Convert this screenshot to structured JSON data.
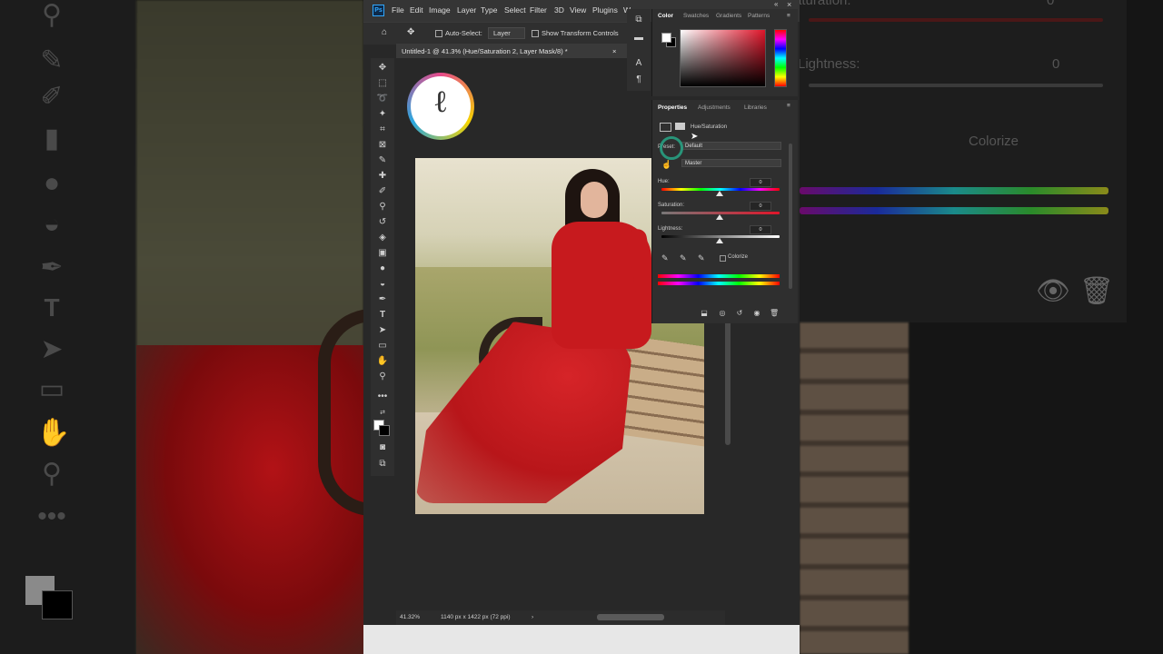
{
  "menubar": {
    "logo": "Ps",
    "items": [
      "File",
      "Edit",
      "Image",
      "Layer",
      "Type",
      "Select",
      "Filter",
      "3D",
      "View",
      "Plugins",
      "W"
    ]
  },
  "options_bar": {
    "auto_select_label": "Auto-Select:",
    "auto_select_value": "Layer",
    "transform_label": "Show Transform Controls"
  },
  "document": {
    "tab_title": "Untitled-1 @ 41.3% (Hue/Saturation 2, Layer Mask/8) *",
    "zoom": "41.32%",
    "dimensions": "1140 px x 1422 px (72 ppi)"
  },
  "color_panel": {
    "tabs": [
      "Color",
      "Swatches",
      "Gradients",
      "Patterns"
    ],
    "active_tab": "Color",
    "foreground": "#ffffff",
    "background": "#000000",
    "selected_hue": "#e0152a"
  },
  "properties_panel": {
    "tabs": [
      "Properties",
      "Adjustments",
      "Libraries"
    ],
    "active_tab": "Properties",
    "adjustment_name": "Hue/Saturation",
    "preset_label": "Preset:",
    "preset_value": "Default",
    "channel_value": "Master",
    "hue_label": "Hue:",
    "hue_value": "0",
    "saturation_label": "Saturation:",
    "saturation_value": "0",
    "lightness_label": "Lightness:",
    "lightness_value": "0",
    "colorize_label": "Colorize"
  },
  "background_panel": {
    "saturation_label": "aturation:",
    "saturation_value": "0",
    "lightness_label": "Lightness:",
    "lightness_value": "0",
    "colorize_label": "Colorize"
  }
}
